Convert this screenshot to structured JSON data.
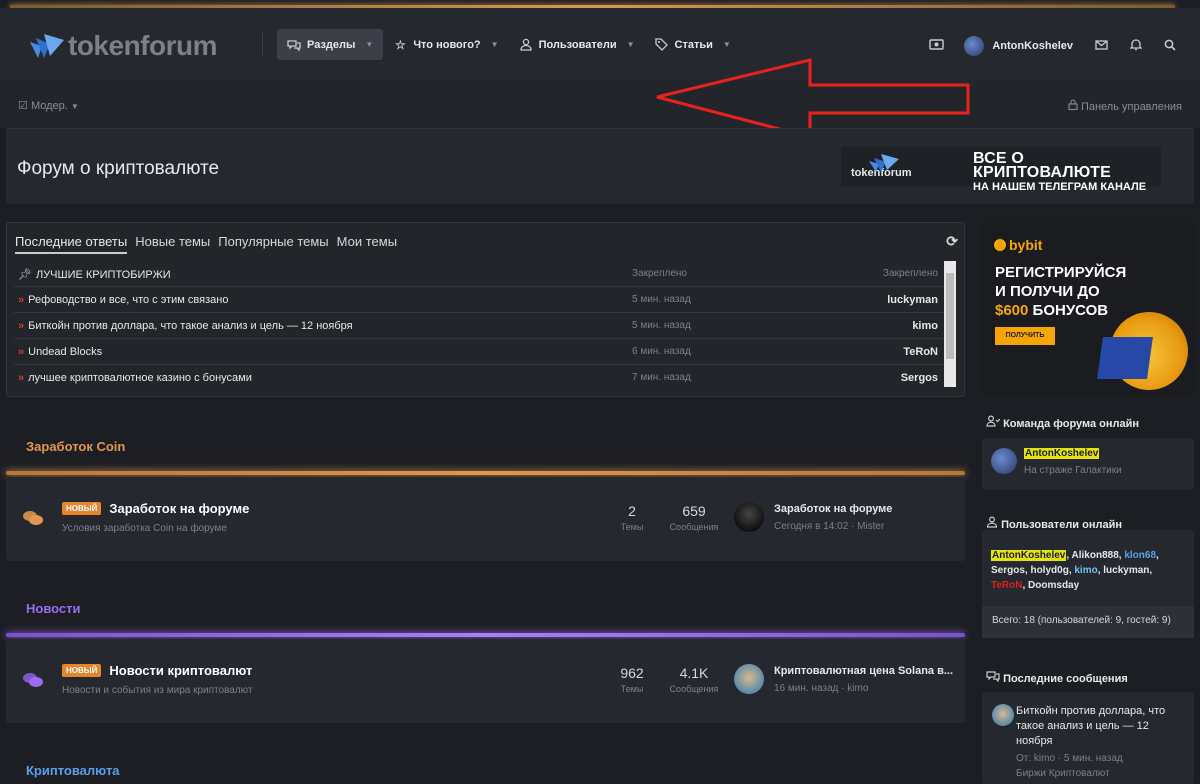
{
  "header": {
    "logo_text": "tokenforum",
    "nav": [
      {
        "label": "Разделы",
        "icon": "chat-icon"
      },
      {
        "label": "Что нового?",
        "icon": "star-icon"
      },
      {
        "label": "Пользователи",
        "icon": "user-icon"
      },
      {
        "label": "Статьи",
        "icon": "tag-icon"
      }
    ],
    "username": "AntonKoshelev"
  },
  "subbar": {
    "moder": "Модер.",
    "panel": "Панель управления"
  },
  "page_title": "Форум о криптовалюте",
  "tg_banner": {
    "logo": "tokenforum",
    "line1": "ВСЕ О КРИПТОВАЛЮТЕ",
    "line2": "НА НАШЕМ ТЕЛЕГРАМ КАНАЛЕ"
  },
  "latest": {
    "tabs": [
      "Последние ответы",
      "Новые темы",
      "Популярные темы",
      "Мои темы"
    ],
    "rows": [
      {
        "title": "ЛУЧШИЕ КРИПТОБИРЖИ",
        "meta": "Закреплено",
        "user": "Закреплено"
      },
      {
        "title": "Рефоводство и все, что с этим связано",
        "meta": "5 мин. назад",
        "user": "luckyman"
      },
      {
        "title": "Биткойн против доллара, что такое анализ и цель — 12 ноября",
        "meta": "5 мин. назад",
        "user": "kimo"
      },
      {
        "title": "Undead Blocks",
        "meta": "6 мин. назад",
        "user": "TeRoN"
      },
      {
        "title": "лучшее криптовалютное казино с бонусами",
        "meta": "7 мин. назад",
        "user": "Sergos"
      }
    ]
  },
  "categories": [
    {
      "title": "Заработок Coin",
      "color": "#e0974e",
      "node": {
        "badge": "НОВЫЙ",
        "title": "Заработок на форуме",
        "desc": "Условия заработка Coin на форуме",
        "threads": "2",
        "threads_label": "Темы",
        "messages": "659",
        "messages_label": "Сообщения",
        "last_title": "Заработок на форуме",
        "last_meta": "Сегодня в 14:02 · Mister"
      }
    },
    {
      "title": "Новости",
      "color": "#9a6cf0",
      "node": {
        "badge": "НОВЫЙ",
        "title": "Новости криптовалют",
        "desc": "Новости и события из мира криптовалют",
        "threads": "962",
        "threads_label": "Темы",
        "messages": "4.1K",
        "messages_label": "Сообщения",
        "last_title": "Криптовалютная цена Solana в...",
        "last_meta": "16 мин. назад · kimo"
      }
    },
    {
      "title": "Криптовалюта",
      "color": "#5aa0e8"
    }
  ],
  "sidebar": {
    "bybit": {
      "brand": "bybit",
      "line1": "РЕГИСТРИРУЙСЯ",
      "line2": "И ПОЛУЧИ ДО",
      "amount": "$600",
      "line3": "БОНУСОВ",
      "button": "ПОЛУЧИТЬ"
    },
    "team": {
      "title": "Команда форума онлайн",
      "name": "AntonKoshelev",
      "role": "На страже Галактики"
    },
    "online": {
      "title": "Пользователи онлайн",
      "users": [
        "AntonKoshelev",
        "Alikon888",
        "klon68",
        "Sergos",
        "holyd0g",
        "kimo",
        "luckyman",
        "TeRoN",
        "Doomsday"
      ],
      "total": "Всего: 18 (пользователей: 9, гостей: 9)"
    },
    "recent": {
      "title": "Последние сообщения",
      "item_title": "Биткойн против доллара, что такое анализ и цель — 12 ноября",
      "item_meta": "От: kimo · 5 мин. назад",
      "item_forum": "Биржи Криптовалют"
    }
  }
}
